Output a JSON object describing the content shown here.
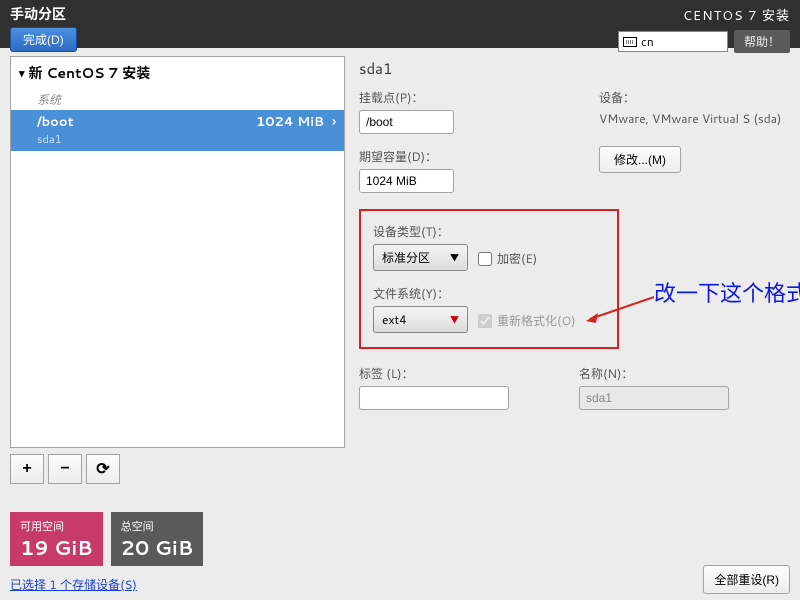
{
  "topbar": {
    "title_left": "手动分区",
    "done": "完成(D)",
    "title_right": "CENTOS 7 安装",
    "lang": "cn",
    "help": "帮助！"
  },
  "tree": {
    "header": "新 CentOS 7 安装",
    "section": "系统",
    "row": {
      "mount": "/boot",
      "size": "1024 MiB",
      "dev": "sda1"
    }
  },
  "buttons": {
    "add": "+",
    "remove": "−",
    "reload": "⟳"
  },
  "detail": {
    "title": "sda1",
    "mountpoint_label": "挂载点(P)：",
    "mountpoint_value": "/boot",
    "capacity_label": "期望容量(D)：",
    "capacity_value": "1024 MiB",
    "device_label": "设备：",
    "device_value": "VMware, VMware Virtual S (sda)",
    "modify": "修改...(M)",
    "devtype_label": "设备类型(T)：",
    "devtype_value": "标准分区",
    "encrypt": "加密(E)",
    "fs_label": "文件系统(Y)：",
    "fs_value": "ext4",
    "reformat": "重新格式化(O)",
    "tag_label": "标签 (L)：",
    "tag_value": "",
    "name_label": "名称(N)：",
    "name_value": "sda1"
  },
  "annotation": "改一下这个格式",
  "footer": {
    "avail_label": "可用空间",
    "avail_value": "19 GiB",
    "total_label": "总空间",
    "total_value": "20 GiB",
    "storage_link": "已选择 1 个存储设备(S)",
    "reset": "全部重设(R)"
  }
}
